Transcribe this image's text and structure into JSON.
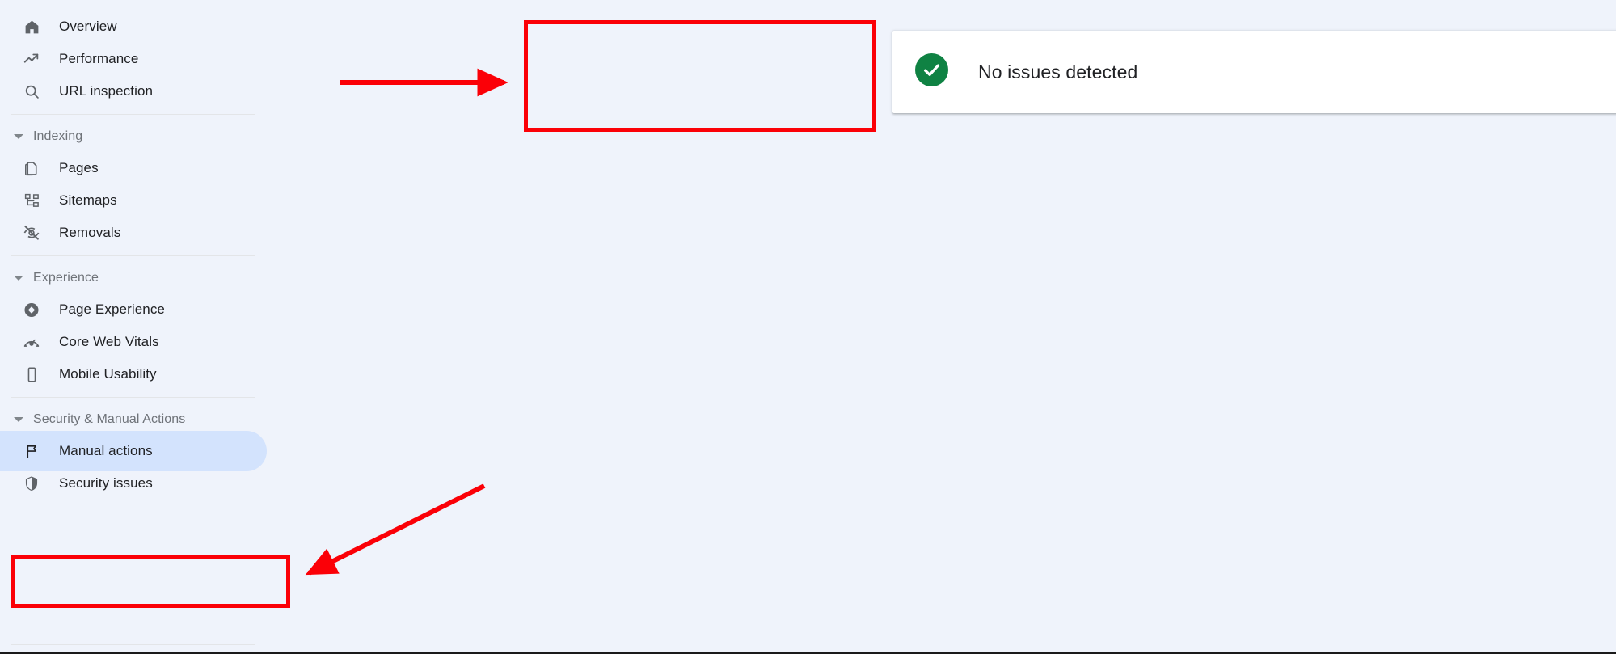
{
  "app": {
    "background_color": "#eff3fb",
    "accent_color": "#d3e3fd",
    "annotation_color": "#fb0007",
    "success_color": "#0f8243"
  },
  "sidebar": {
    "top_items": [
      {
        "label": "Overview",
        "icon": "home-icon",
        "selected": false
      },
      {
        "label": "Performance",
        "icon": "trending-up-icon",
        "selected": false
      },
      {
        "label": "URL inspection",
        "icon": "search-icon",
        "selected": false
      }
    ],
    "sections": [
      {
        "title": "Indexing",
        "caret": "caret-down-icon",
        "items": [
          {
            "label": "Pages",
            "icon": "pages-copy-icon",
            "selected": false
          },
          {
            "label": "Sitemaps",
            "icon": "sitemap-tree-icon",
            "selected": false
          },
          {
            "label": "Removals",
            "icon": "eye-off-icon",
            "selected": false
          }
        ]
      },
      {
        "title": "Experience",
        "caret": "caret-down-icon",
        "items": [
          {
            "label": "Page Experience",
            "icon": "page-experience-diamond-icon",
            "selected": false
          },
          {
            "label": "Core Web Vitals",
            "icon": "speedometer-icon",
            "selected": false
          },
          {
            "label": "Mobile Usability",
            "icon": "mobile-phone-icon",
            "selected": false
          }
        ]
      },
      {
        "title": "Security & Manual Actions",
        "caret": "caret-down-icon",
        "items": [
          {
            "label": "Manual actions",
            "icon": "flag-icon",
            "selected": true
          },
          {
            "label": "Security issues",
            "icon": "shield-icon",
            "selected": false
          }
        ]
      }
    ]
  },
  "main": {
    "status_card": {
      "icon": "check-circle-icon",
      "message": "No issues detected"
    }
  },
  "annotations": {
    "boxes": [
      {
        "name": "highlight-status-card"
      },
      {
        "name": "highlight-manual-actions"
      }
    ],
    "arrows": [
      {
        "name": "arrow-to-status-card",
        "direction": "right"
      },
      {
        "name": "arrow-to-manual-actions",
        "direction": "down-left"
      }
    ]
  }
}
